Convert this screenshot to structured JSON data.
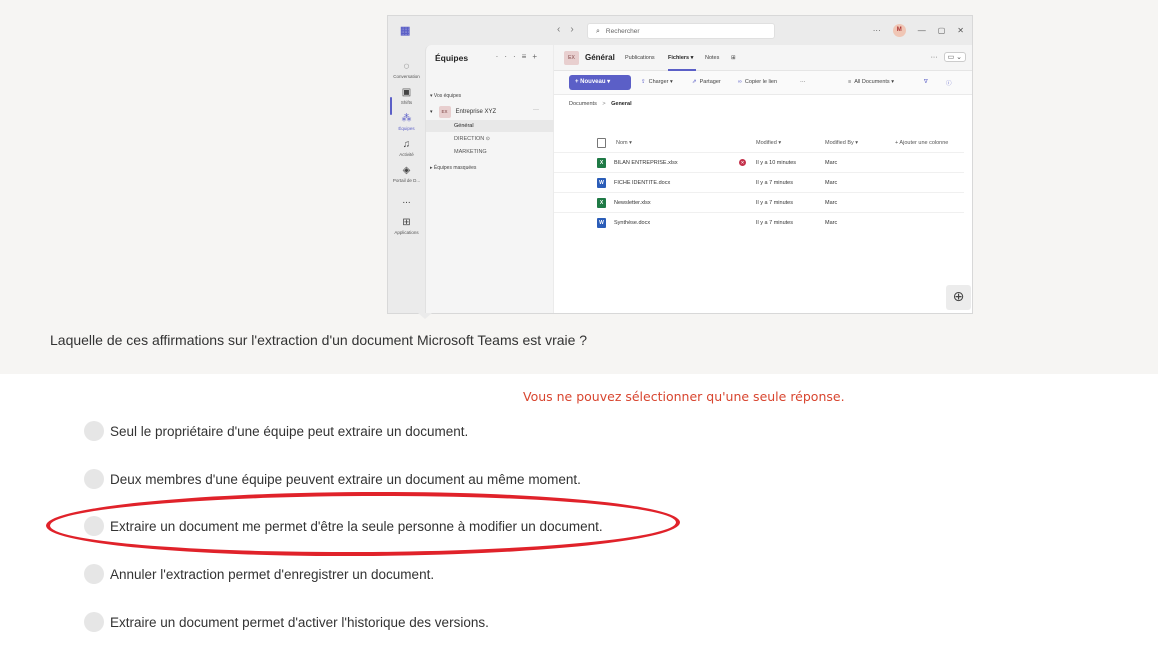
{
  "teams": {
    "search_placeholder": "Rechercher",
    "avatar_initial": "M",
    "rail": [
      {
        "label": "Conversation",
        "icon": "chat-icon"
      },
      {
        "label": "Shifts",
        "icon": "calendar-icon"
      },
      {
        "label": "Équipes",
        "icon": "teams-icon"
      },
      {
        "label": "Activité",
        "icon": "bell-icon"
      },
      {
        "label": "Portail de D...",
        "icon": "portal-icon"
      },
      {
        "label": "...",
        "icon": "more-icon"
      },
      {
        "label": "Applications",
        "icon": "apps-icon"
      }
    ],
    "panel_title": "Équipes",
    "section_my_teams": "▾ Vos équipes",
    "team_badge": "EX",
    "team_name": "Entreprise XYZ",
    "channels": [
      "Général",
      "DIRECTION",
      "MARKETING"
    ],
    "section_hidden": "▸ Équipes masquées",
    "channel_badge": "EX",
    "channel_title": "Général",
    "tabs": [
      "Publications",
      "Fichiers ▾",
      "Notes",
      "⊞"
    ],
    "new_button": "+ Nouveau ▾",
    "toolbar": {
      "upload": "Charger ▾",
      "share": "Partager",
      "copy_link": "Copier le lien",
      "more": "···",
      "view": "All Documents ▾"
    },
    "breadcrumb_root": "Documents",
    "breadcrumb_sep": ">",
    "breadcrumb_current": "General",
    "columns": {
      "name": "Nom ▾",
      "modified": "Modified ▾",
      "modified_by": "Modified By ▾",
      "add_column": "+ Ajouter une colonne"
    },
    "files": [
      {
        "name": "BILAN ENTREPRISE.xlsx",
        "type": "x",
        "modified": "Il y a 10 minutes",
        "by": "Marc",
        "locked": true
      },
      {
        "name": "FICHE IDENTITE.docx",
        "type": "w",
        "modified": "Il y a 7 minutes",
        "by": "Marc",
        "locked": false
      },
      {
        "name": "Newsletter.xlsx",
        "type": "x",
        "modified": "Il y a 7 minutes",
        "by": "Marc",
        "locked": false
      },
      {
        "name": "Synthèse.docx",
        "type": "w",
        "modified": "Il y a 7 minutes",
        "by": "Marc",
        "locked": false
      }
    ]
  },
  "question": "Laquelle de ces affirmations sur l'extraction d'un document Microsoft Teams est vraie ?",
  "instruction": "Vous ne pouvez sélectionner qu'une seule réponse.",
  "options": [
    "Seul le propriétaire d'une équipe peut extraire un document.",
    "Deux membres d'une équipe peuvent extraire un document au même moment.",
    "Extraire un document me permet d'être la seule personne à modifier un document.",
    "Annuler l'extraction permet d'enregistrer un document.",
    "Extraire un document permet d'activer l'historique des versions."
  ],
  "colors": {
    "accent": "#5b5fc7",
    "instruction": "#d8452f",
    "highlight": "#e0222a"
  }
}
